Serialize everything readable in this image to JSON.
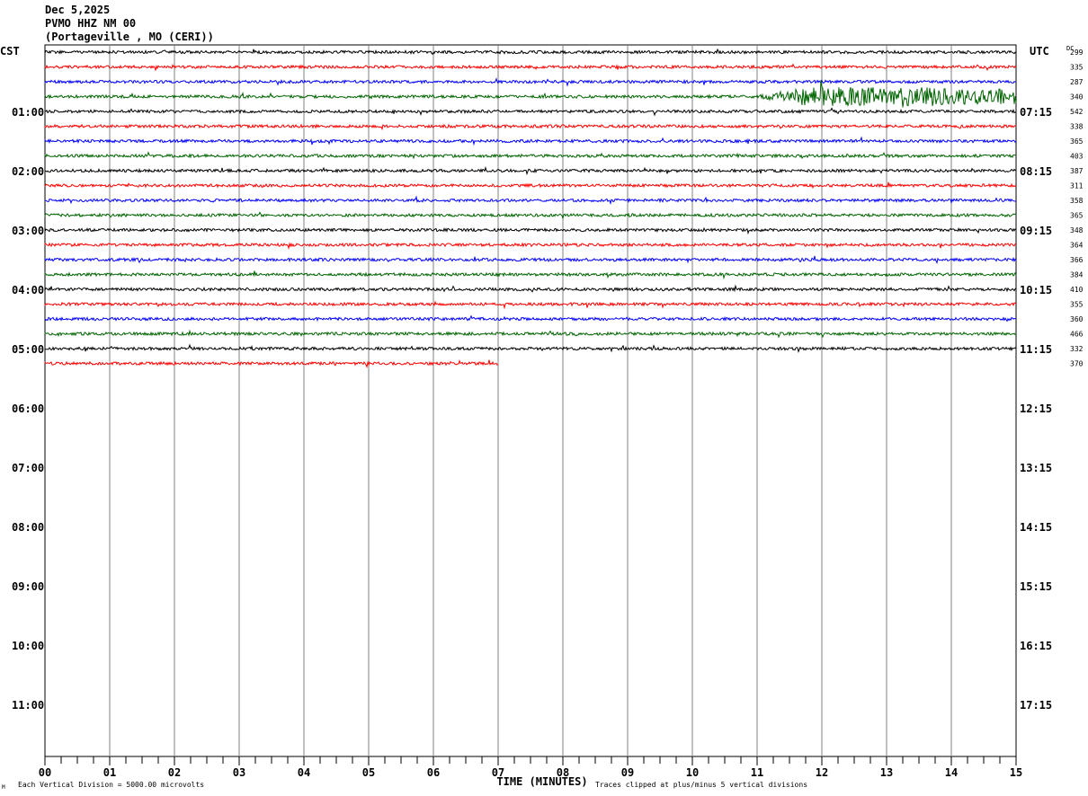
{
  "header": {
    "date": "Dec 5,2025",
    "station": "PVMO HHZ NM 00",
    "location": "(Portageville , MO (CERI))"
  },
  "chart_data": {
    "type": "line",
    "title": "PVMO HHZ NM 00 helicorder",
    "left_axis_label": "CST",
    "right_axis_label": "UTC",
    "dc_label": "DC",
    "xlabel": "TIME (MINUTES)",
    "x_ticks": [
      "00",
      "01",
      "02",
      "03",
      "04",
      "05",
      "06",
      "07",
      "08",
      "09",
      "10",
      "11",
      "12",
      "13",
      "14",
      "15"
    ],
    "xlim": [
      0,
      15
    ],
    "rows_per_hour": 4,
    "total_rows": 48,
    "cst_labels": [
      "01:00",
      "02:00",
      "03:00",
      "04:00",
      "05:00",
      "06:00",
      "07:00",
      "08:00",
      "09:00",
      "10:00",
      "11:00"
    ],
    "utc_labels": [
      "07:15",
      "08:15",
      "09:15",
      "10:15",
      "11:15",
      "12:15",
      "13:15",
      "14:15",
      "15:15",
      "16:15",
      "17:15"
    ],
    "trace_colors": [
      "#000000",
      "#ff0000",
      "#0000ff",
      "#006400"
    ],
    "dc_values": [
      "299",
      "335",
      "287",
      "340",
      "542",
      "338",
      "365",
      "403",
      "387",
      "311",
      "358",
      "365",
      "348",
      "364",
      "366",
      "384",
      "410",
      "355",
      "360",
      "466",
      "332",
      "370"
    ],
    "last_trace_end_minute": 7,
    "event": {
      "row": 3,
      "start_minute": 11.0,
      "peak_minute": 12.7,
      "end_minute": 15
    },
    "scale_note": "Each Vertical Division = 5000.00 microvolts",
    "clip_note": "Traces clipped at plus/minus 5 vertical divisions",
    "corner_mark": "M"
  }
}
